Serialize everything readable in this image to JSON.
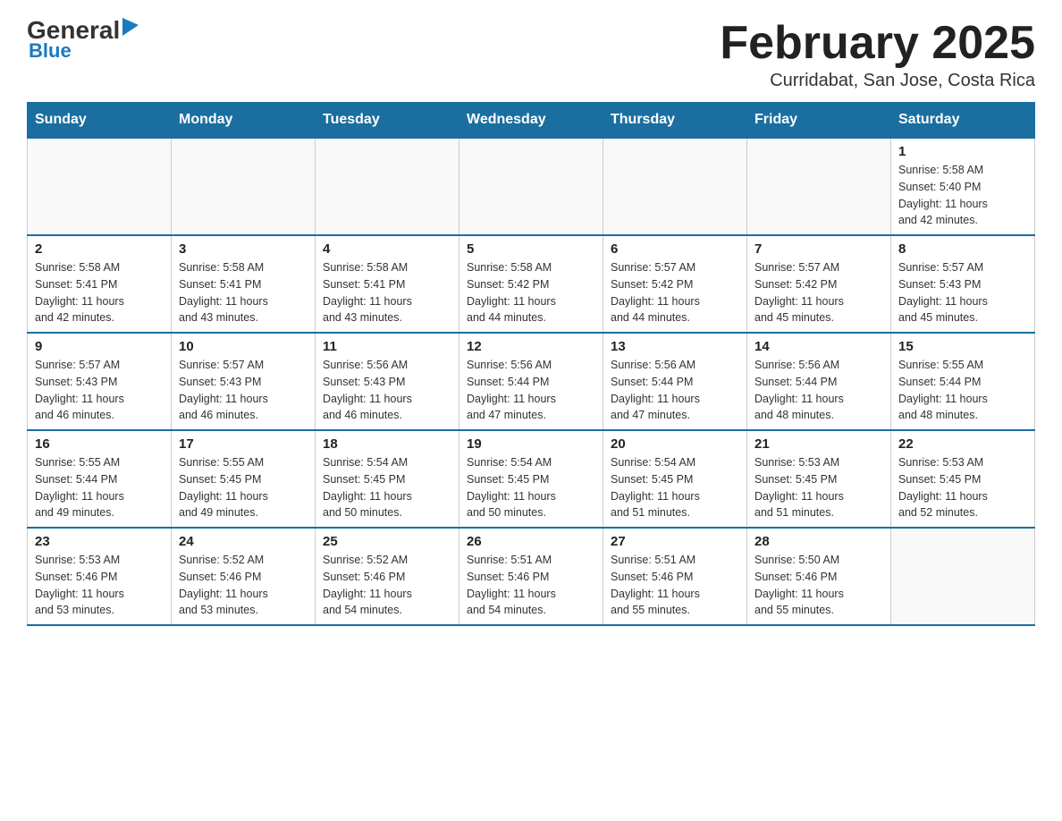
{
  "header": {
    "logo_general": "General",
    "logo_blue": "Blue",
    "month_title": "February 2025",
    "location": "Curridabat, San Jose, Costa Rica"
  },
  "weekdays": [
    "Sunday",
    "Monday",
    "Tuesday",
    "Wednesday",
    "Thursday",
    "Friday",
    "Saturday"
  ],
  "weeks": [
    [
      {
        "day": "",
        "info": ""
      },
      {
        "day": "",
        "info": ""
      },
      {
        "day": "",
        "info": ""
      },
      {
        "day": "",
        "info": ""
      },
      {
        "day": "",
        "info": ""
      },
      {
        "day": "",
        "info": ""
      },
      {
        "day": "1",
        "info": "Sunrise: 5:58 AM\nSunset: 5:40 PM\nDaylight: 11 hours\nand 42 minutes."
      }
    ],
    [
      {
        "day": "2",
        "info": "Sunrise: 5:58 AM\nSunset: 5:41 PM\nDaylight: 11 hours\nand 42 minutes."
      },
      {
        "day": "3",
        "info": "Sunrise: 5:58 AM\nSunset: 5:41 PM\nDaylight: 11 hours\nand 43 minutes."
      },
      {
        "day": "4",
        "info": "Sunrise: 5:58 AM\nSunset: 5:41 PM\nDaylight: 11 hours\nand 43 minutes."
      },
      {
        "day": "5",
        "info": "Sunrise: 5:58 AM\nSunset: 5:42 PM\nDaylight: 11 hours\nand 44 minutes."
      },
      {
        "day": "6",
        "info": "Sunrise: 5:57 AM\nSunset: 5:42 PM\nDaylight: 11 hours\nand 44 minutes."
      },
      {
        "day": "7",
        "info": "Sunrise: 5:57 AM\nSunset: 5:42 PM\nDaylight: 11 hours\nand 45 minutes."
      },
      {
        "day": "8",
        "info": "Sunrise: 5:57 AM\nSunset: 5:43 PM\nDaylight: 11 hours\nand 45 minutes."
      }
    ],
    [
      {
        "day": "9",
        "info": "Sunrise: 5:57 AM\nSunset: 5:43 PM\nDaylight: 11 hours\nand 46 minutes."
      },
      {
        "day": "10",
        "info": "Sunrise: 5:57 AM\nSunset: 5:43 PM\nDaylight: 11 hours\nand 46 minutes."
      },
      {
        "day": "11",
        "info": "Sunrise: 5:56 AM\nSunset: 5:43 PM\nDaylight: 11 hours\nand 46 minutes."
      },
      {
        "day": "12",
        "info": "Sunrise: 5:56 AM\nSunset: 5:44 PM\nDaylight: 11 hours\nand 47 minutes."
      },
      {
        "day": "13",
        "info": "Sunrise: 5:56 AM\nSunset: 5:44 PM\nDaylight: 11 hours\nand 47 minutes."
      },
      {
        "day": "14",
        "info": "Sunrise: 5:56 AM\nSunset: 5:44 PM\nDaylight: 11 hours\nand 48 minutes."
      },
      {
        "day": "15",
        "info": "Sunrise: 5:55 AM\nSunset: 5:44 PM\nDaylight: 11 hours\nand 48 minutes."
      }
    ],
    [
      {
        "day": "16",
        "info": "Sunrise: 5:55 AM\nSunset: 5:44 PM\nDaylight: 11 hours\nand 49 minutes."
      },
      {
        "day": "17",
        "info": "Sunrise: 5:55 AM\nSunset: 5:45 PM\nDaylight: 11 hours\nand 49 minutes."
      },
      {
        "day": "18",
        "info": "Sunrise: 5:54 AM\nSunset: 5:45 PM\nDaylight: 11 hours\nand 50 minutes."
      },
      {
        "day": "19",
        "info": "Sunrise: 5:54 AM\nSunset: 5:45 PM\nDaylight: 11 hours\nand 50 minutes."
      },
      {
        "day": "20",
        "info": "Sunrise: 5:54 AM\nSunset: 5:45 PM\nDaylight: 11 hours\nand 51 minutes."
      },
      {
        "day": "21",
        "info": "Sunrise: 5:53 AM\nSunset: 5:45 PM\nDaylight: 11 hours\nand 51 minutes."
      },
      {
        "day": "22",
        "info": "Sunrise: 5:53 AM\nSunset: 5:45 PM\nDaylight: 11 hours\nand 52 minutes."
      }
    ],
    [
      {
        "day": "23",
        "info": "Sunrise: 5:53 AM\nSunset: 5:46 PM\nDaylight: 11 hours\nand 53 minutes."
      },
      {
        "day": "24",
        "info": "Sunrise: 5:52 AM\nSunset: 5:46 PM\nDaylight: 11 hours\nand 53 minutes."
      },
      {
        "day": "25",
        "info": "Sunrise: 5:52 AM\nSunset: 5:46 PM\nDaylight: 11 hours\nand 54 minutes."
      },
      {
        "day": "26",
        "info": "Sunrise: 5:51 AM\nSunset: 5:46 PM\nDaylight: 11 hours\nand 54 minutes."
      },
      {
        "day": "27",
        "info": "Sunrise: 5:51 AM\nSunset: 5:46 PM\nDaylight: 11 hours\nand 55 minutes."
      },
      {
        "day": "28",
        "info": "Sunrise: 5:50 AM\nSunset: 5:46 PM\nDaylight: 11 hours\nand 55 minutes."
      },
      {
        "day": "",
        "info": ""
      }
    ]
  ]
}
